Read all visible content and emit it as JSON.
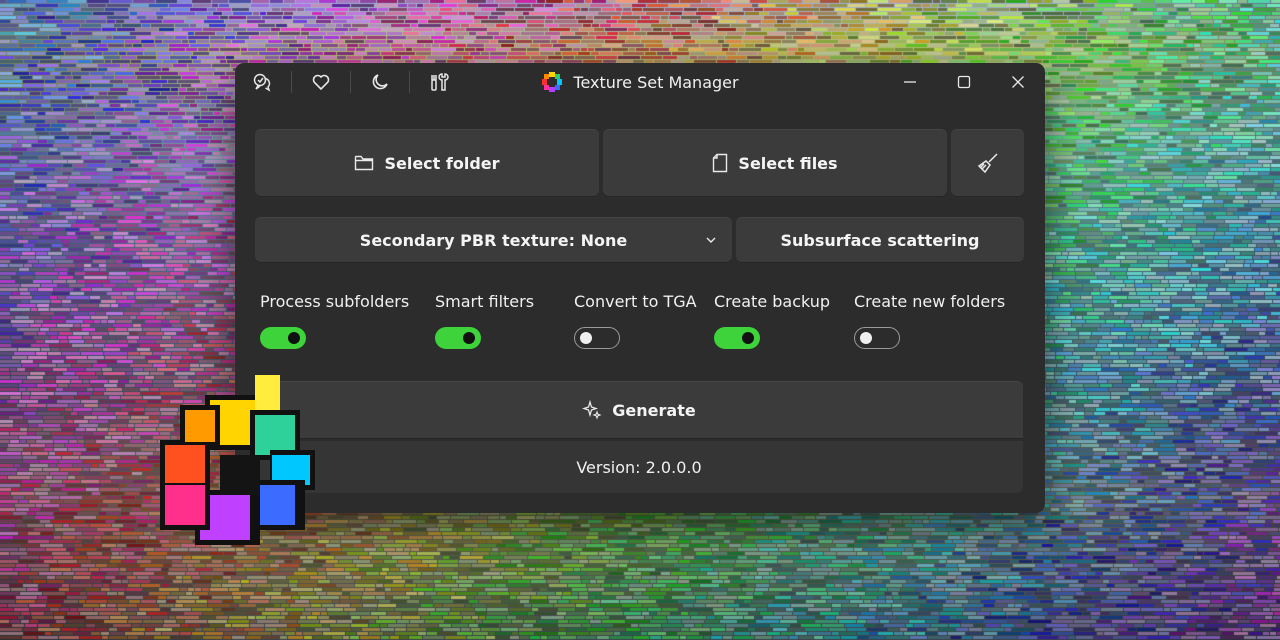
{
  "window": {
    "title": "Texture Set Manager",
    "title_icon": "rainbow-cog-icon",
    "controls": [
      "minimize-icon",
      "maximize-icon",
      "close-icon"
    ]
  },
  "toolbar": {
    "icons": [
      "chat-bubbles-icon",
      "heart-icon",
      "moon-icon",
      "tools-icon"
    ]
  },
  "actions": {
    "select_folder": "Select folder",
    "select_files": "Select files",
    "clear_icon": "broom-icon"
  },
  "options": {
    "secondary_texture": "Secondary PBR texture: None",
    "subsurface": "Subsurface scattering"
  },
  "toggles": [
    {
      "label": "Process subfolders",
      "on": true
    },
    {
      "label": "Smart filters",
      "on": true
    },
    {
      "label": "Convert to TGA",
      "on": false
    },
    {
      "label": "Create backup",
      "on": true
    },
    {
      "label": "Create new folders",
      "on": false
    }
  ],
  "generate": {
    "label": "Generate"
  },
  "version": "Version: 2.0.0.0",
  "colors": {
    "accent_green": "#3ed33a",
    "window_bg": "#2c2c2c",
    "button_bg": "#3b3b3b"
  }
}
